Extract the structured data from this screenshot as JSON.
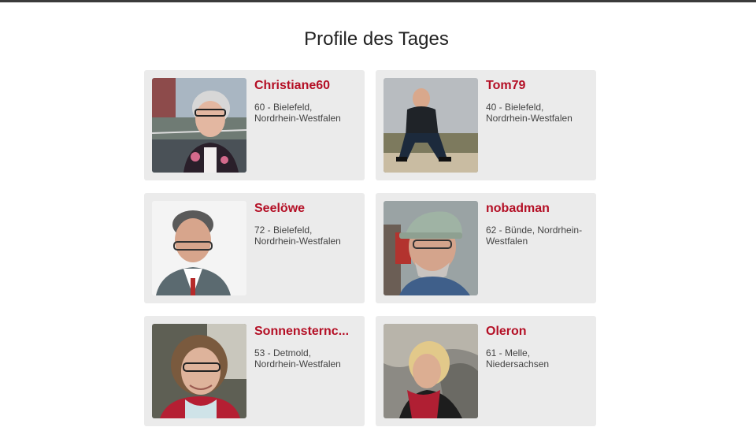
{
  "page": {
    "title": "Profile des Tages"
  },
  "profiles": [
    {
      "name": "Christiane60",
      "age_location": "60 - Bielefeld,",
      "region": "Nordrhein-Westfalen"
    },
    {
      "name": "Tom79",
      "age_location": "40 - Bielefeld,",
      "region": "Nordrhein-Westfalen"
    },
    {
      "name": "Seelöwe",
      "age_location": "72 - Bielefeld,",
      "region": "Nordrhein-Westfalen"
    },
    {
      "name": "nobadman",
      "age_location": "62 - Bünde, Nordrhein-",
      "region": "Westfalen"
    },
    {
      "name": "Sonnensternc...",
      "age_location": "53 - Detmold,",
      "region": "Nordrhein-Westfalen"
    },
    {
      "name": "Oleron",
      "age_location": "61 - Melle,",
      "region": "Niedersachsen"
    }
  ],
  "colors": {
    "name": "#b40f25",
    "card": "#ebebeb",
    "top_bar": "#3b3b3b"
  }
}
